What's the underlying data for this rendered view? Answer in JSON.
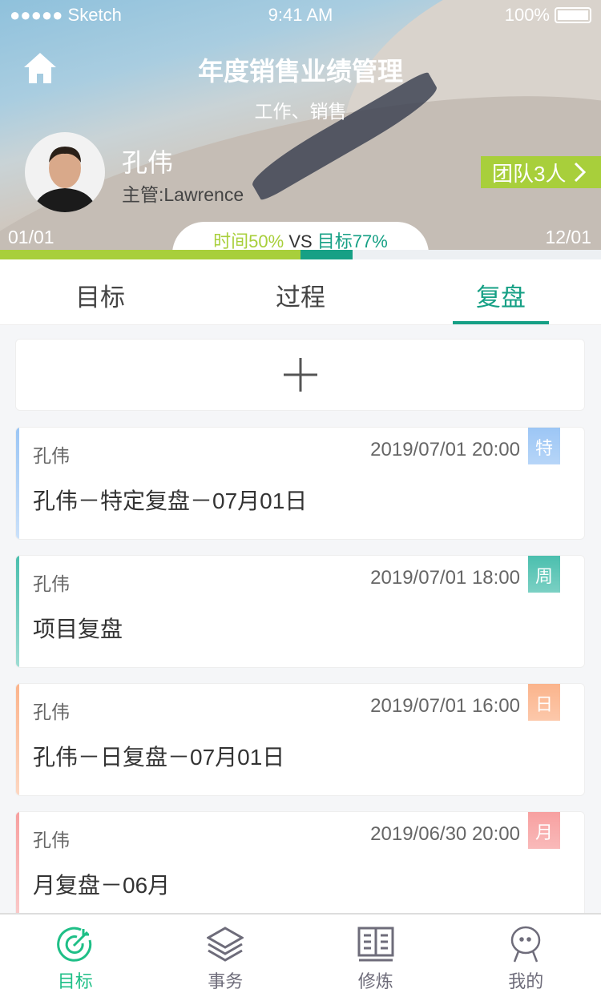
{
  "status": {
    "carrier": "●●●●● Sketch",
    "time": "9:41 AM",
    "battery": "100%"
  },
  "header": {
    "title": "年度销售业绩管理",
    "subtitle": "工作、销售",
    "name": "孔伟",
    "manager": "主管:Lawrence",
    "team": "团队3人",
    "start": "01/01",
    "end": "12/01",
    "time_label": "时间50%",
    "vs": "VS",
    "goal_label": "目标77%",
    "time_progress": 50,
    "goal_progress": 77
  },
  "colors": {
    "accent": "#16a085",
    "lime": "#a8cf3b"
  },
  "tabs": [
    {
      "label": "目标"
    },
    {
      "label": "过程"
    },
    {
      "label": "复盘",
      "active": true
    }
  ],
  "cards": [
    {
      "who": "孔伟",
      "time": "2019/07/01 20:00",
      "tag": "特",
      "title": "孔伟－特定复盘－07月01日",
      "color": "#9cc6f5"
    },
    {
      "who": "孔伟",
      "time": "2019/07/01 18:00",
      "tag": "周",
      "title": "项目复盘",
      "color": "#4bbfae"
    },
    {
      "who": "孔伟",
      "time": "2019/07/01 16:00",
      "tag": "日",
      "title": "孔伟－日复盘－07月01日",
      "color": "#fbb48c"
    },
    {
      "who": "孔伟",
      "time": "2019/06/30 20:00",
      "tag": "月",
      "title": "月复盘－06月",
      "color": "#f7a0a0"
    }
  ],
  "nav": [
    {
      "label": "目标",
      "icon": "target-icon",
      "active": true
    },
    {
      "label": "事务",
      "icon": "layers-icon"
    },
    {
      "label": "修炼",
      "icon": "book-icon"
    },
    {
      "label": "我的",
      "icon": "person-icon"
    }
  ]
}
